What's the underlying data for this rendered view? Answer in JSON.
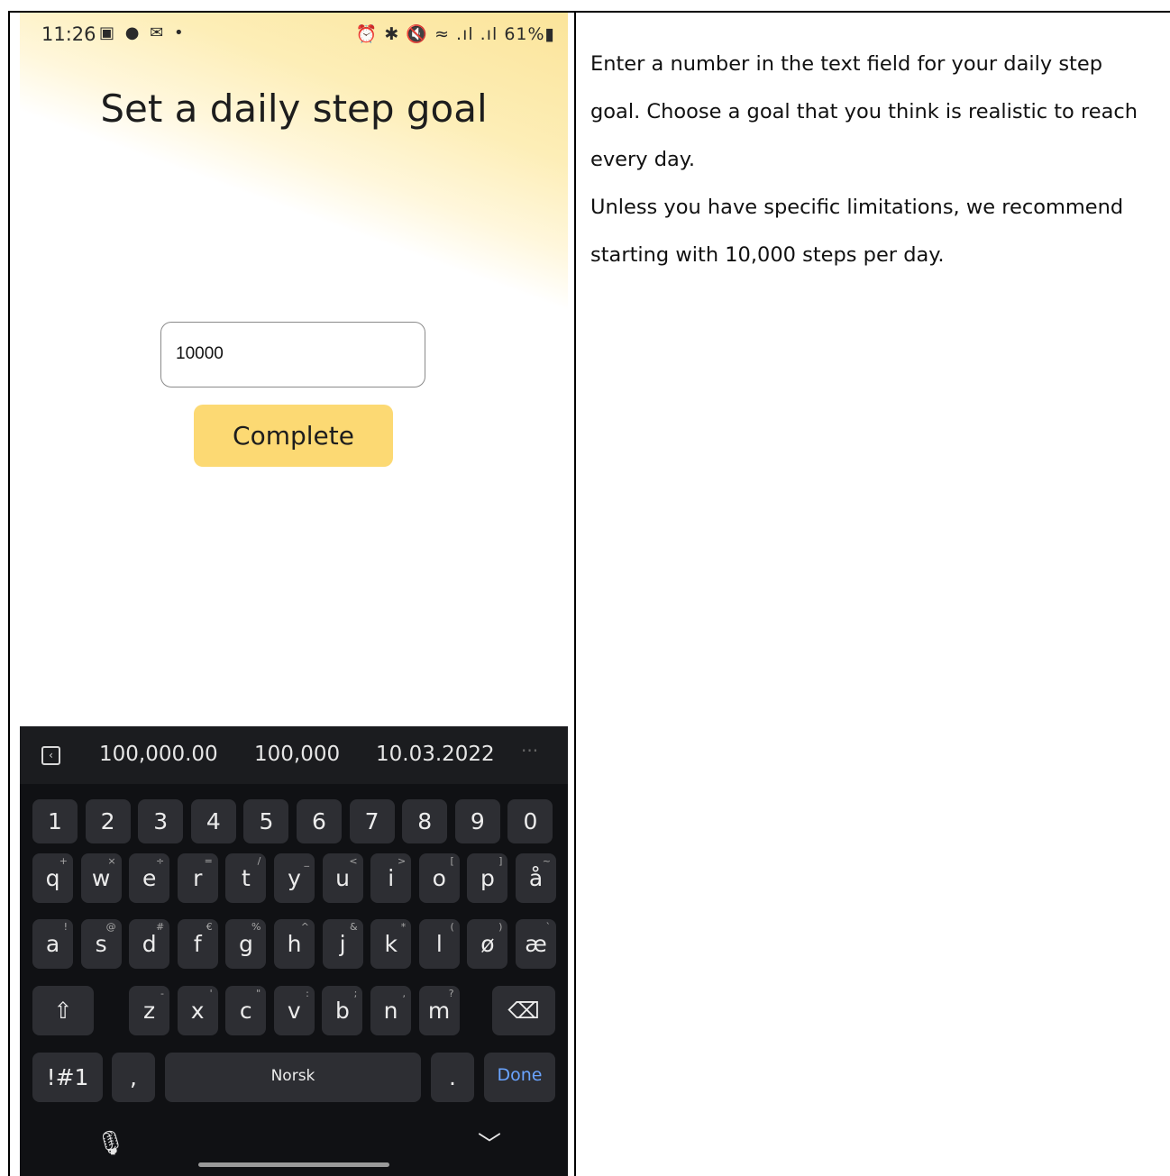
{
  "status_bar": {
    "time": "11:26",
    "left_icons": "▣ ● ✉ •",
    "right_icons": "⏰ ✱ 🔇 ≈ .ıl .ıl",
    "battery": "61%▮"
  },
  "screen": {
    "title": "Set a daily step goal",
    "input_value": "10000",
    "complete_label": "Complete"
  },
  "keyboard": {
    "suggestions": [
      "100,000.00",
      "100,000",
      "10.03.2022"
    ],
    "collapse_icon": "‹",
    "more": "···",
    "number_row": [
      "1",
      "2",
      "3",
      "4",
      "5",
      "6",
      "7",
      "8",
      "9",
      "0"
    ],
    "row1": [
      [
        "q",
        "+"
      ],
      [
        "w",
        "×"
      ],
      [
        "e",
        "÷"
      ],
      [
        "r",
        "="
      ],
      [
        "t",
        "/"
      ],
      [
        "y",
        "_"
      ],
      [
        "u",
        "<"
      ],
      [
        "i",
        ">"
      ],
      [
        "o",
        "["
      ],
      [
        "p",
        "]"
      ],
      [
        "å",
        "~"
      ]
    ],
    "row2": [
      [
        "a",
        "!"
      ],
      [
        "s",
        "@"
      ],
      [
        "d",
        "#"
      ],
      [
        "f",
        "€"
      ],
      [
        "g",
        "%"
      ],
      [
        "h",
        "^"
      ],
      [
        "j",
        "&"
      ],
      [
        "k",
        "*"
      ],
      [
        "l",
        "("
      ],
      [
        "ø",
        ")"
      ],
      [
        "æ",
        "`"
      ]
    ],
    "row3": [
      [
        "z",
        "-"
      ],
      [
        "x",
        "'"
      ],
      [
        "c",
        "\""
      ],
      [
        "v",
        ":"
      ],
      [
        "b",
        ";"
      ],
      [
        "n",
        ","
      ],
      [
        "m",
        "?"
      ]
    ],
    "shift": "⇧",
    "backspace": "⌫",
    "symbols": "!#1",
    "comma": ",",
    "space": "Norsk",
    "period": ".",
    "done": "Done",
    "mic": "🎙",
    "hide": "﹀"
  },
  "instructions": [
    "Enter a number in the text field for your daily step goal. Choose a goal that you think is realistic to reach every day.",
    "Unless you have specific limitations, we recommend starting with 10,000 steps per day."
  ],
  "colors": {
    "button": "#fcd973",
    "done": "#6aa4ff",
    "keyboard_bg": "#101114",
    "key_bg": "#2d2e33"
  }
}
